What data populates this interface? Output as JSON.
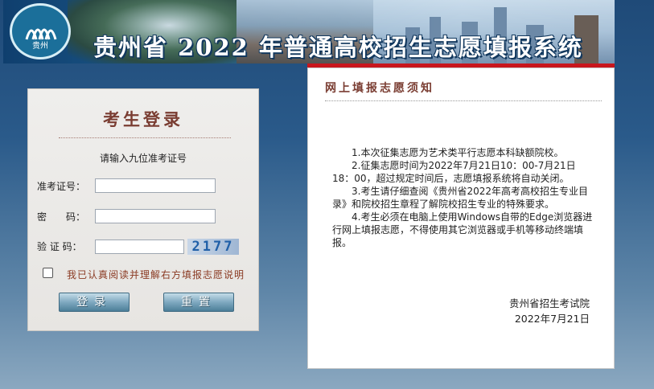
{
  "header": {
    "logo_text": "贵州",
    "title": "贵州省 2022 年普通高校招生志愿填报系统"
  },
  "login": {
    "title": "考生登录",
    "hint": "请输入九位准考证号",
    "fields": {
      "exam_no_label": "准考证号：",
      "password_label": "密　　码：",
      "captcha_label": "验 证 码："
    },
    "captcha_value": "2177",
    "agree_text": "我已认真阅读并理解右方填报志愿说明",
    "login_button": "登录",
    "reset_button": "重置"
  },
  "notice": {
    "title": "网上填报志愿须知",
    "items": [
      "1.本次征集志愿为艺术类平行志愿本科缺额院校。",
      "2.征集志愿时间为2022年7月21日10：00-7月21日18：00，超过规定时间后，志愿填报系统将自动关闭。",
      "3.考生请仔细查阅《贵州省2022年高考高校招生专业目录》和院校招生章程了解院校招生专业的特殊要求。",
      "4.考生必须在电脑上使用Windows自带的Edge浏览器进行网上填报志愿，不得使用其它浏览器或手机等移动终端填报。"
    ],
    "signature": "贵州省招生考试院",
    "date": "2022年7月21日"
  }
}
